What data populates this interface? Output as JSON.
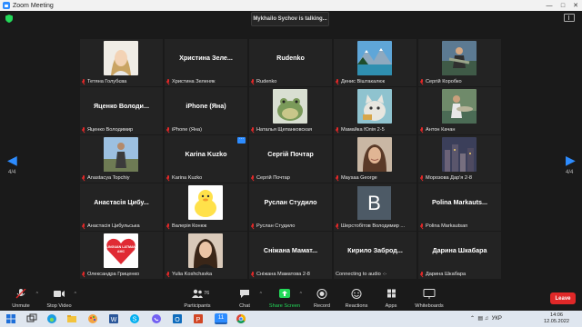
{
  "window": {
    "title": "Zoom Meeting"
  },
  "talking_banner": "Mykhailo Sychov is talking...",
  "pager": {
    "left": "4/4",
    "right": "4/4"
  },
  "tiles": [
    {
      "label": "Тетяна Голубєва",
      "kind": "photo",
      "photo": "face-blonde",
      "muted": true
    },
    {
      "label": "Христина Зеленяк",
      "name": "Христина  Зеле...",
      "kind": "name",
      "muted": true
    },
    {
      "label": "Rudenko",
      "name": "Rudenko",
      "kind": "name",
      "muted": true
    },
    {
      "label": "Денис Віштакалюк",
      "kind": "photo",
      "photo": "mountains",
      "muted": true
    },
    {
      "label": "Сергій Коробко",
      "kind": "photo",
      "photo": "man-fishing",
      "muted": true
    },
    {
      "label": "Яценко Володимир",
      "name": "Яценко  Володи...",
      "kind": "name",
      "muted": true
    },
    {
      "label": "iPhone (Яна)",
      "name": "iPhone (Яна)",
      "kind": "name",
      "muted": true
    },
    {
      "label": "Наталья Щепанковская",
      "kind": "photo",
      "photo": "frog",
      "muted": true
    },
    {
      "label": "Мамайка Юлія 2-5",
      "kind": "photo",
      "photo": "cat-cartoon",
      "muted": true
    },
    {
      "label": "Антон Качан",
      "kind": "photo",
      "photo": "man-fish",
      "muted": true
    },
    {
      "label": "Anastacya Topchiy",
      "kind": "photo",
      "photo": "person-outdoor",
      "muted": true
    },
    {
      "label": "Karina Kuzko",
      "name": "Karina Kuzko",
      "kind": "name",
      "muted": true,
      "more": true
    },
    {
      "label": "Сергій Почтар",
      "name": "Сергій Почтар",
      "kind": "name",
      "muted": true
    },
    {
      "label": "Maysaa George",
      "kind": "photo",
      "photo": "woman-smile",
      "muted": true
    },
    {
      "label": "Морозова Дар'я 2-8",
      "kind": "photo",
      "photo": "city-night",
      "muted": true
    },
    {
      "label": "Анастасія Цибульська",
      "name": "Анастасія  Цибу...",
      "kind": "name",
      "muted": true
    },
    {
      "label": "Валерія Конюк",
      "kind": "photo",
      "photo": "duck",
      "muted": true
    },
    {
      "label": "Руслан Студило",
      "name": "Руслан Студило",
      "kind": "name",
      "muted": true
    },
    {
      "label": "Шерстобітов Володимир ...",
      "kind": "letter",
      "letter": "B",
      "muted": true
    },
    {
      "label": "Polina Markautsan",
      "name": "Polina  Markauts...",
      "kind": "name",
      "muted": true
    },
    {
      "label": "Олександра Гриценко",
      "kind": "photo",
      "photo": "heart-logo",
      "muted": true,
      "logo_text": "LINGUAN LATMAN AMC"
    },
    {
      "label": "Yulia Koshchavka",
      "kind": "photo",
      "photo": "woman-portrait",
      "muted": true
    },
    {
      "label": "Сніжана Маматова 2-8",
      "name": "Сніжана  Мамат...",
      "kind": "name",
      "muted": true
    },
    {
      "label": "Connecting to audio ·:·",
      "name": "Кирило  Заброд...",
      "kind": "name",
      "muted": false
    },
    {
      "label": "Дарина Шкабара",
      "name": "Дарина Шкабара",
      "kind": "name",
      "muted": true
    }
  ],
  "toolbar": {
    "unmute": "Unmute",
    "stop_video": "Stop Video",
    "participants": "Participants",
    "participants_count": "76",
    "chat": "Chat",
    "share_screen": "Share Screen",
    "record": "Record",
    "reactions": "Reactions",
    "apps": "Apps",
    "whiteboards": "Whiteboards",
    "leave": "Leave"
  },
  "colors": {
    "accent": "#2d8cff",
    "share_green": "#23d959",
    "leave_red": "#e02828",
    "muted_red": "#e02828"
  },
  "taskbar": {
    "lang": "УКР",
    "time": "14:06",
    "date": "12.05.2022",
    "zoom_badge": "11"
  }
}
